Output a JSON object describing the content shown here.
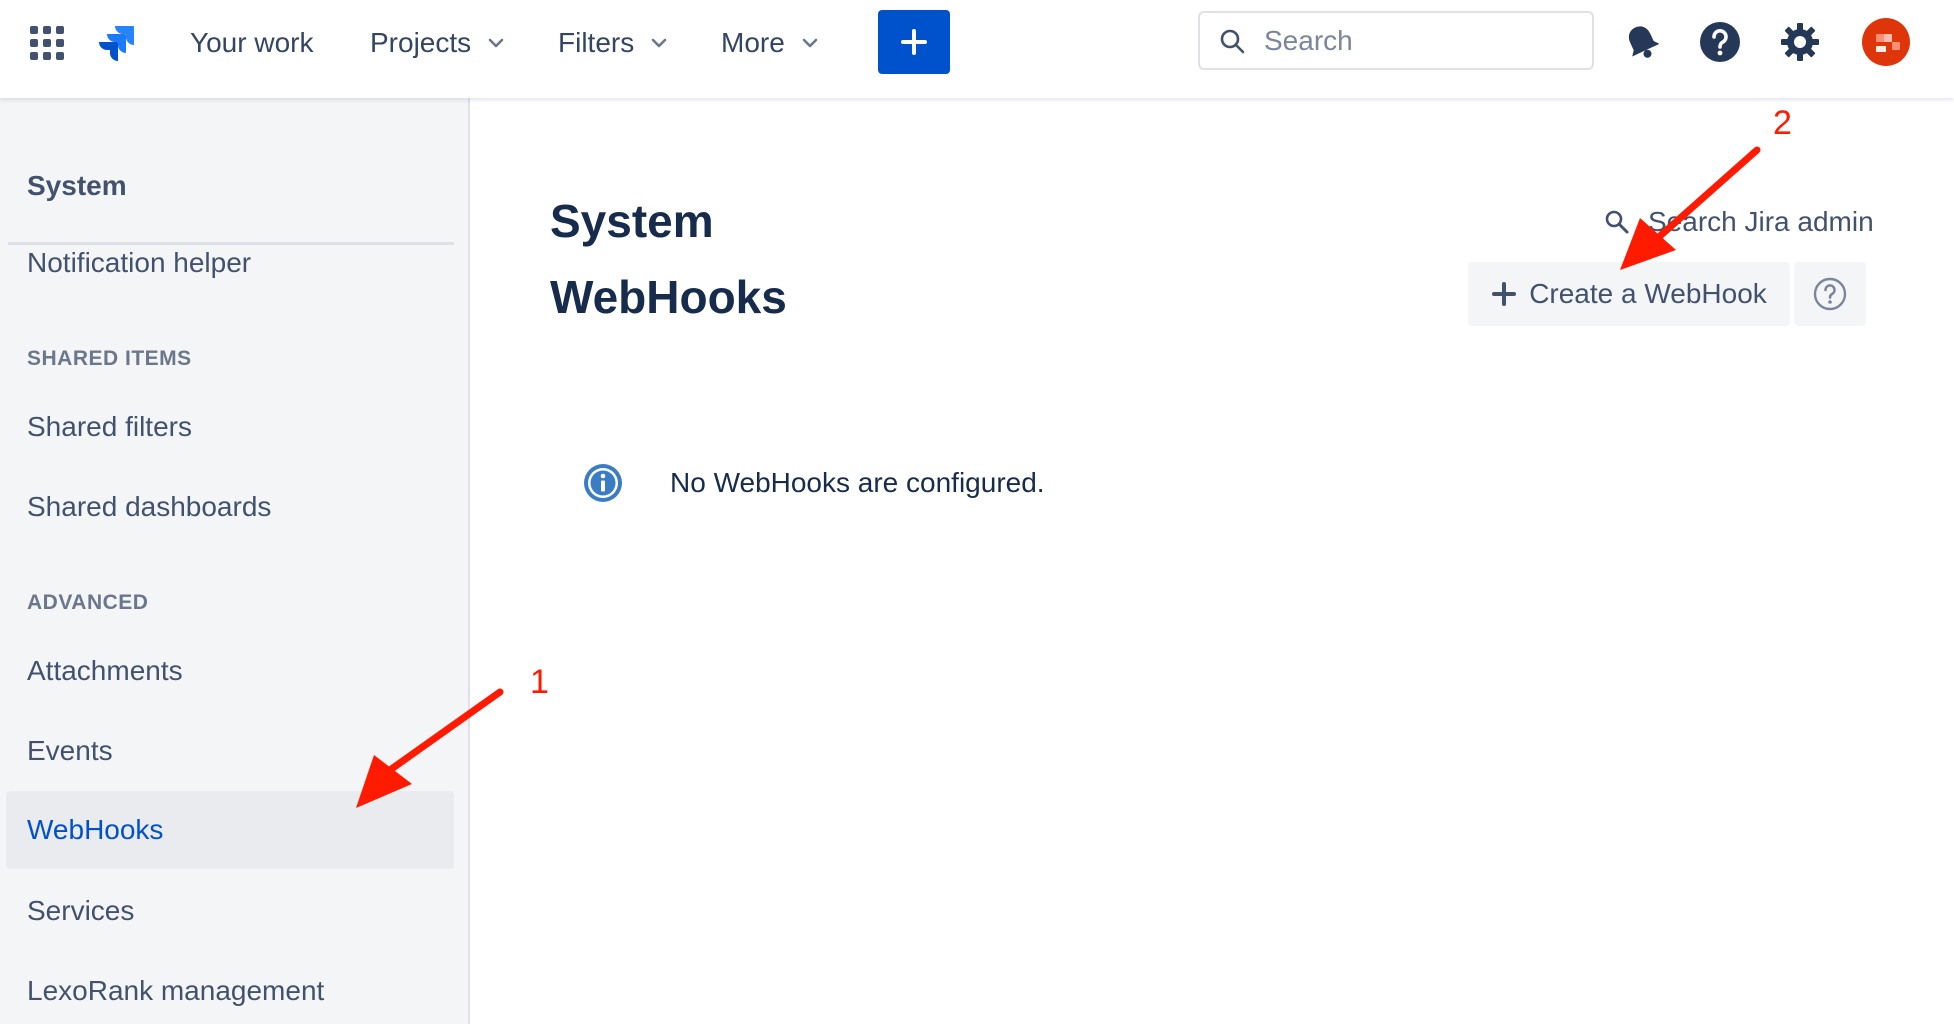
{
  "topnav": {
    "items": [
      {
        "label": "Your work"
      },
      {
        "label": "Projects"
      },
      {
        "label": "Filters"
      },
      {
        "label": "More"
      }
    ],
    "search_placeholder": "Search",
    "create_icon": "plus-icon",
    "icons": [
      "apps-grid-icon",
      "jira-logo-icon",
      "notifications-bell-icon",
      "help-icon",
      "settings-gear-icon",
      "avatar"
    ]
  },
  "sidebar": {
    "title": "System",
    "items_top": [
      {
        "label": "Notification helper"
      }
    ],
    "sections": [
      {
        "heading": "SHARED ITEMS",
        "items": [
          {
            "label": "Shared filters"
          },
          {
            "label": "Shared dashboards"
          }
        ]
      },
      {
        "heading": "ADVANCED",
        "items": [
          {
            "label": "Attachments"
          },
          {
            "label": "Events"
          },
          {
            "label": "WebHooks",
            "active": true
          },
          {
            "label": "Services"
          },
          {
            "label": "LexoRank management"
          }
        ]
      }
    ]
  },
  "main": {
    "title_line1": "System",
    "title_line2": "WebHooks",
    "admin_search_label": "Search Jira admin",
    "create_button_label": "Create a WebHook",
    "empty_message": "No WebHooks are configured."
  },
  "annotations": {
    "num1": "1",
    "num2": "2"
  },
  "colors": {
    "primary": "#0052cc",
    "annotation": "#ff1a00",
    "sidebar_bg": "#f4f5f7",
    "avatar": "#de350b"
  }
}
